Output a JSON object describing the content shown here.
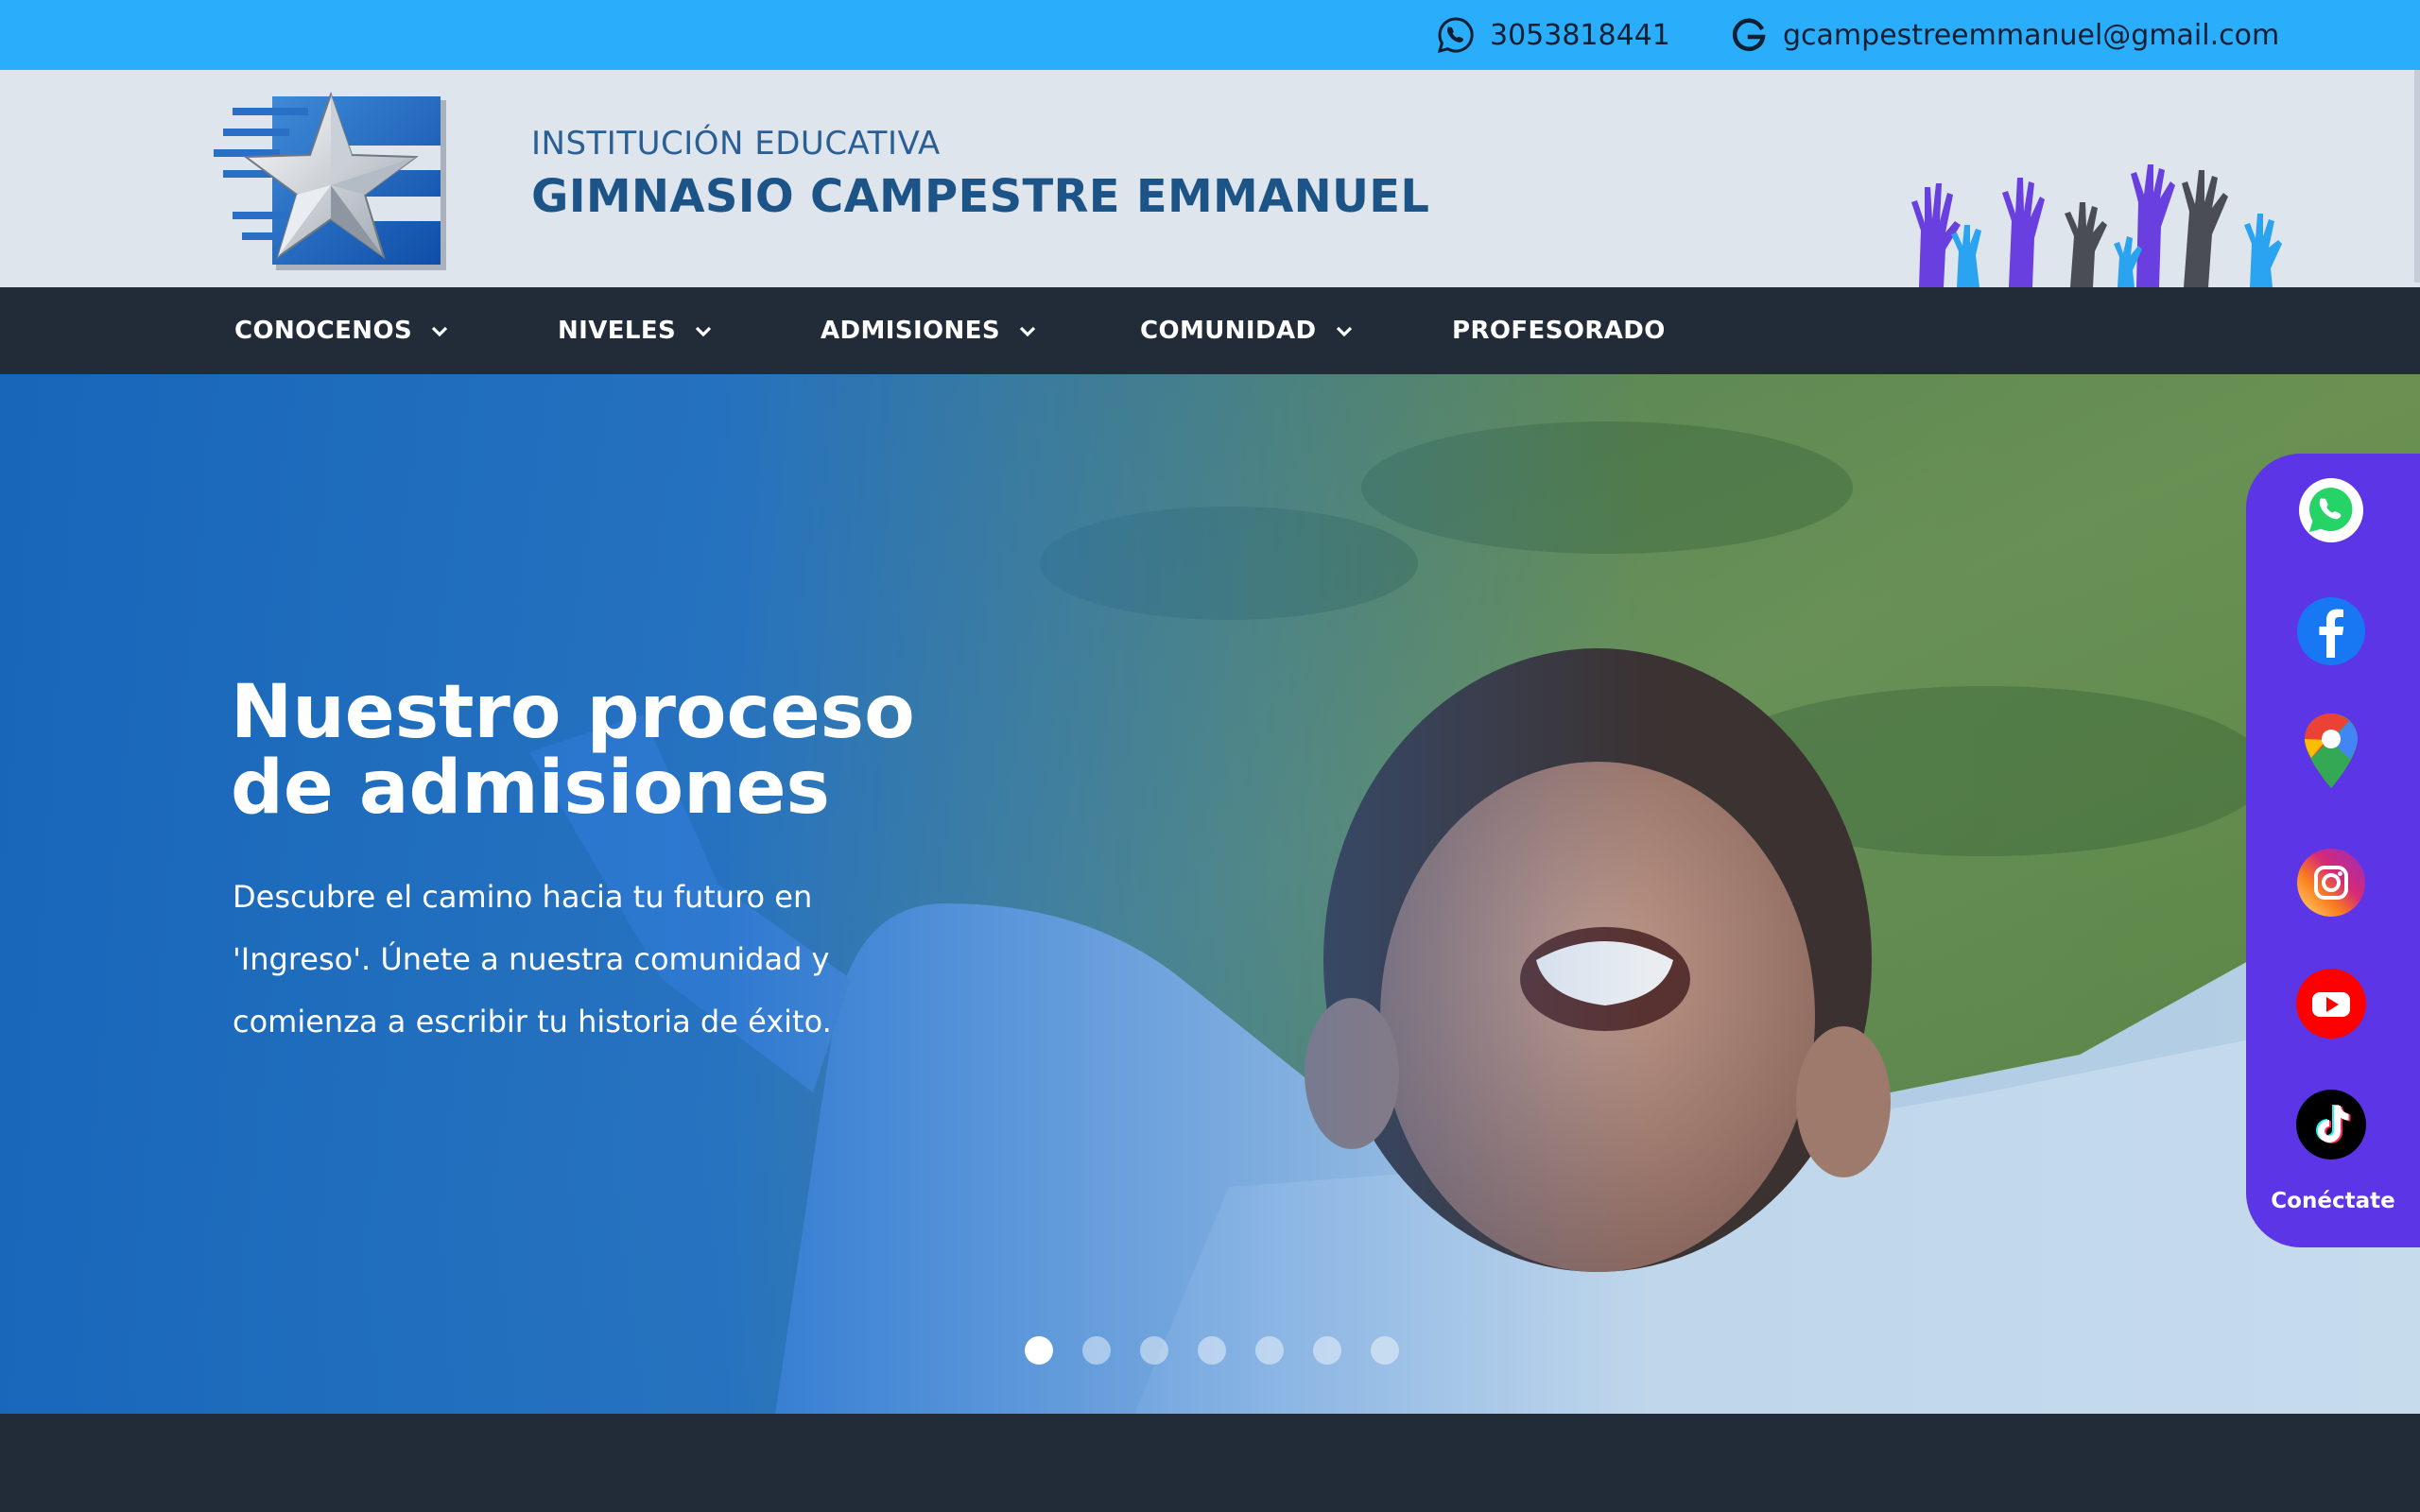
{
  "topbar": {
    "phone": "3053818441",
    "email": "gcampestreemmanuel@gmail.com",
    "phone_icon": "whatsapp-icon",
    "email_icon": "google-icon"
  },
  "header": {
    "subtitle": "INSTITUCIÓN EDUCATIVA",
    "title": "GIMNASIO CAMPESTRE EMMANUEL"
  },
  "nav": {
    "items": [
      {
        "label": "CONOCENOS",
        "has_dropdown": true
      },
      {
        "label": "NIVELES",
        "has_dropdown": true
      },
      {
        "label": "ADMISIONES",
        "has_dropdown": true
      },
      {
        "label": "COMUNIDAD",
        "has_dropdown": true
      },
      {
        "label": "PROFESORADO",
        "has_dropdown": false
      }
    ]
  },
  "hero": {
    "title_line1": "Nuestro proceso",
    "title_line2": "de admisiones",
    "description": "Descubre el camino hacia tu futuro en 'Ingreso'. Únete a nuestra comunidad y comienza a escribir tu historia de éxito.",
    "slides_total": 7,
    "active_slide": 1
  },
  "social": {
    "label": "Conéctate",
    "items": [
      "whatsapp-icon",
      "facebook-icon",
      "google-maps-icon",
      "instagram-icon",
      "youtube-icon",
      "tiktok-icon"
    ]
  },
  "colors": {
    "topbar": "#2aaefb",
    "header_bg": "#dfe5ec",
    "nav_bg": "#222c38",
    "brand_blue": "#1d5488",
    "social_panel": "#5b35e6"
  }
}
